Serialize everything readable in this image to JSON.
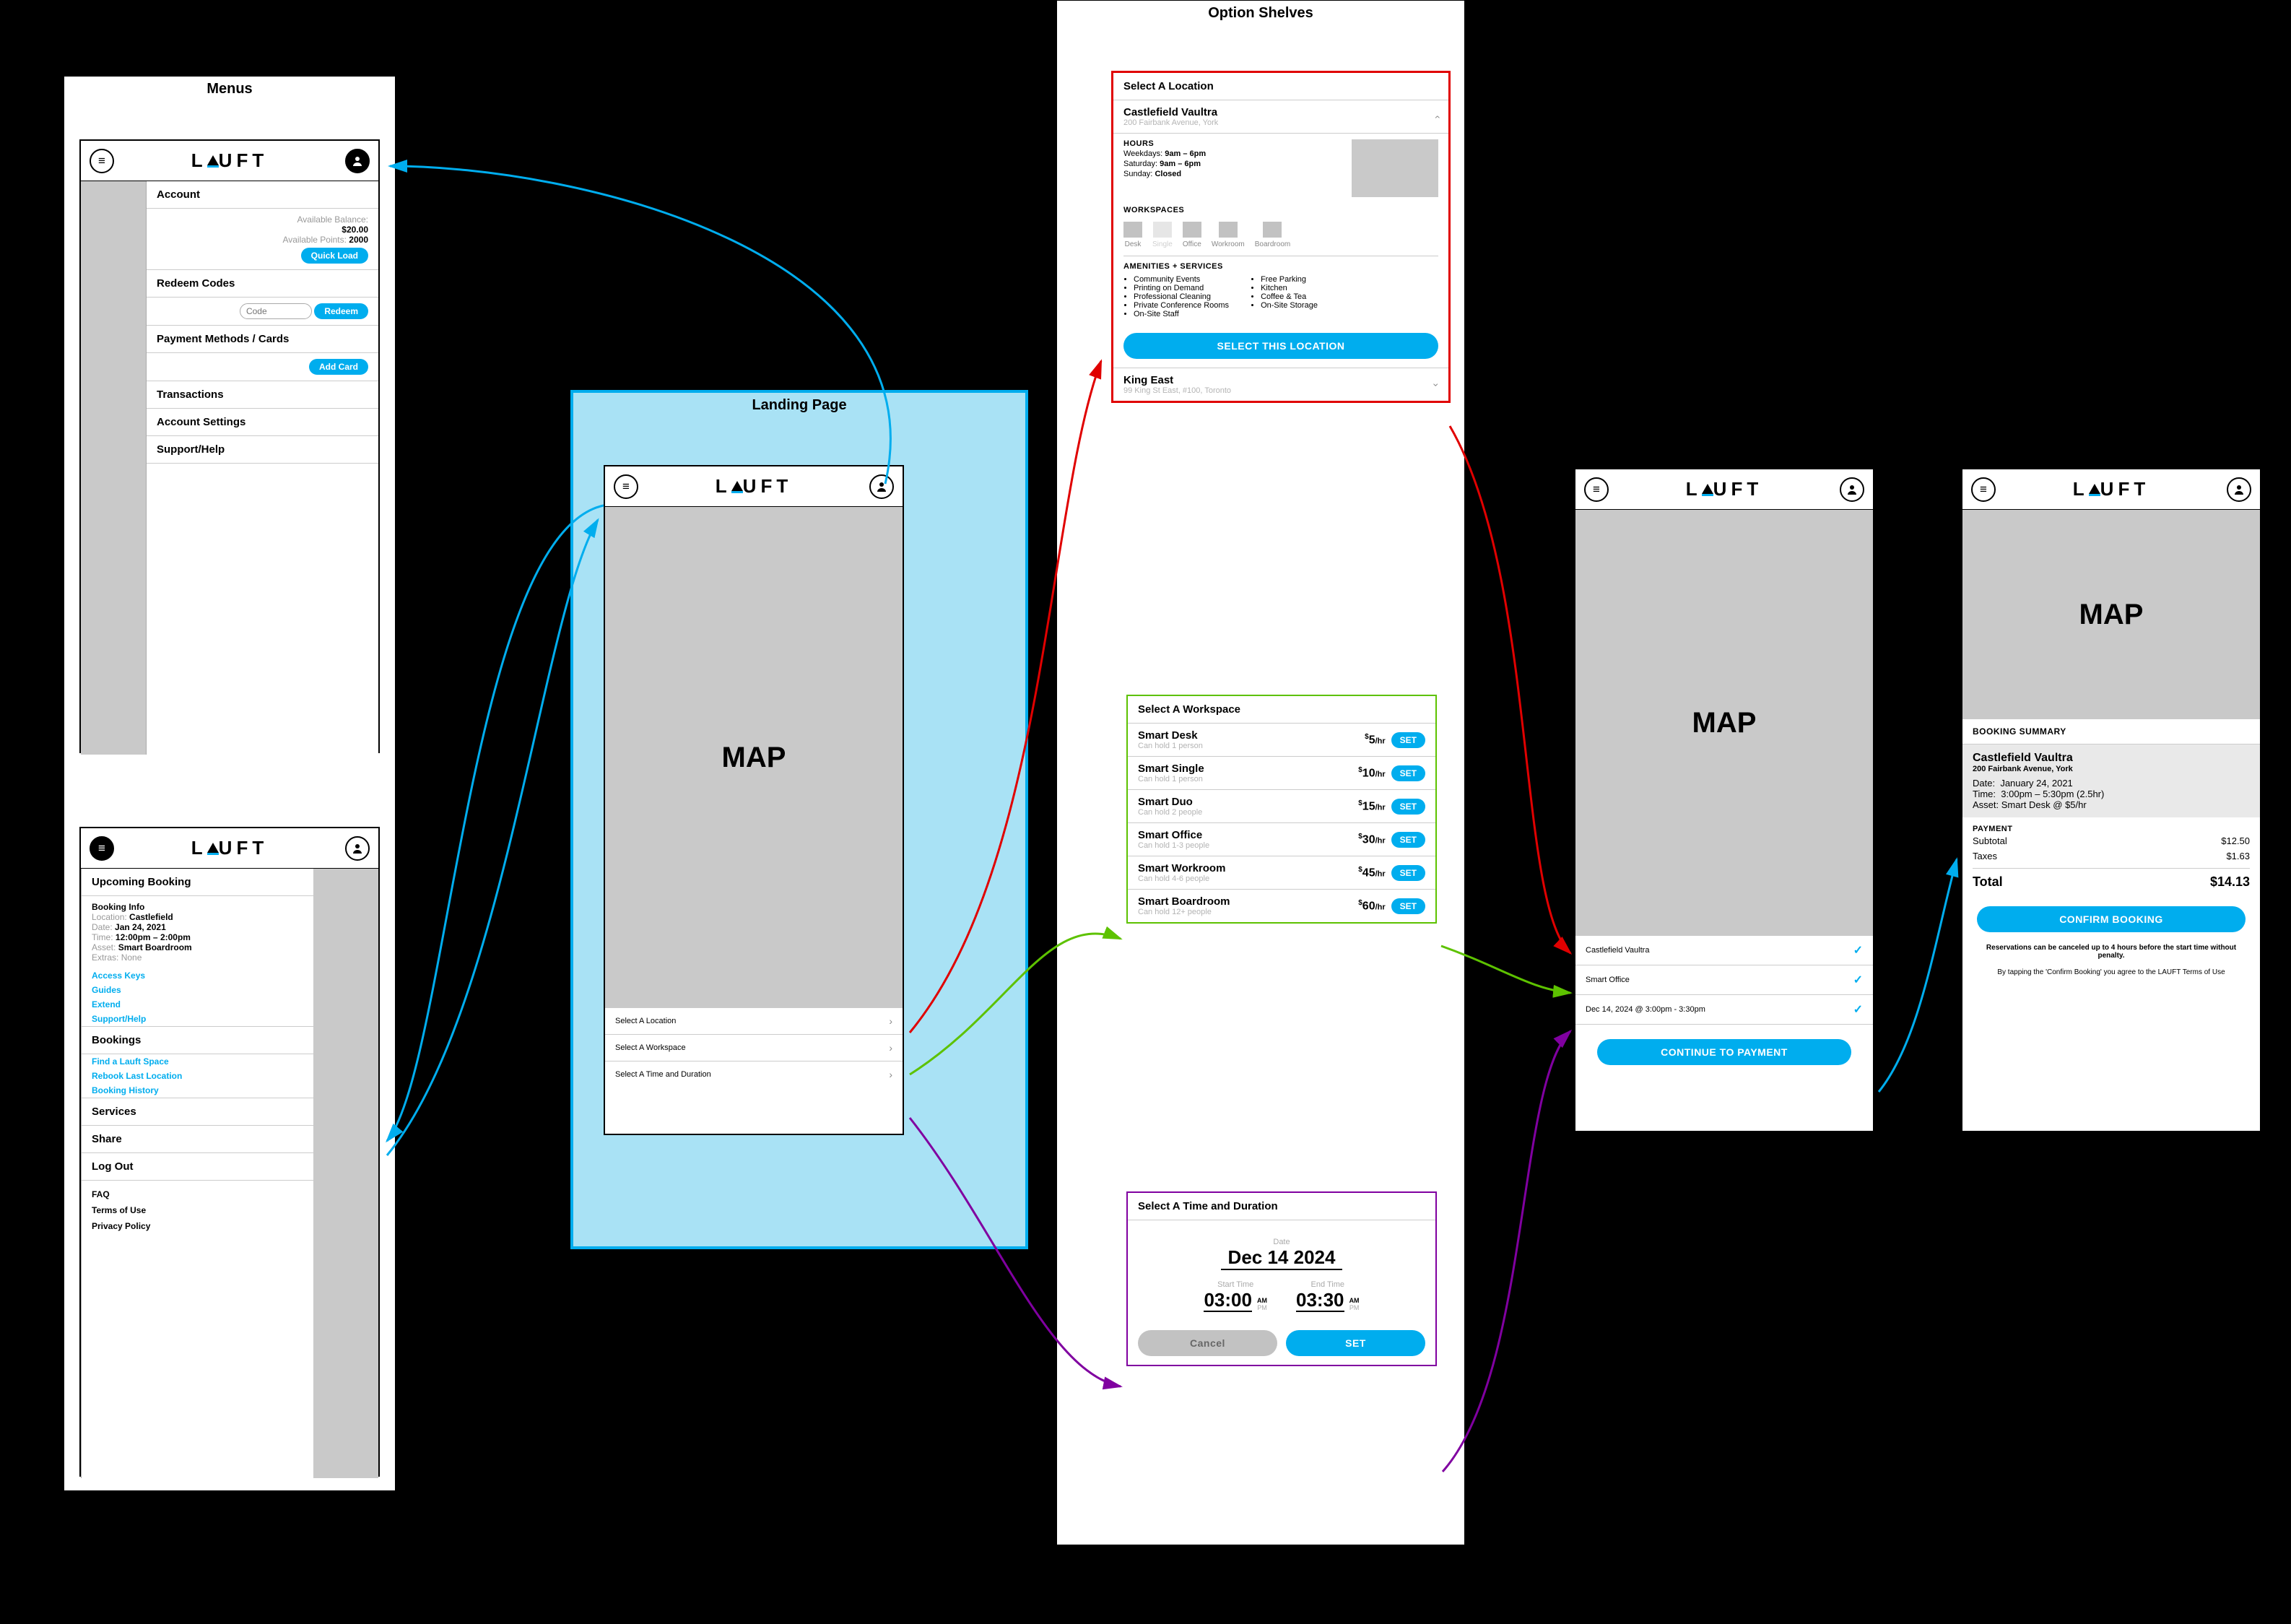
{
  "groups": {
    "menus": "Menus",
    "landing": "Landing Page",
    "shelves": "Option Shelves"
  },
  "logo": "LAUFT",
  "map_label": "MAP",
  "account_menu": {
    "header": "Account",
    "avail_bal_lbl": "Available Balance:",
    "avail_bal": "$20.00",
    "avail_pts_lbl": "Available Points:",
    "avail_pts": "2000",
    "quick_load": "Quick Load",
    "redeem_hd": "Redeem Codes",
    "code_ph": "Code",
    "redeem_btn": "Redeem",
    "pay_hd": "Payment Methods / Cards",
    "add_card": "Add Card",
    "transactions": "Transactions",
    "acct_settings": "Account Settings",
    "support": "Support/Help"
  },
  "main_menu": {
    "upcoming_hd": "Upcoming Booking",
    "info_hd": "Booking Info",
    "loc_lbl": "Location:",
    "loc": "Castlefield",
    "date_lbl": "Date:",
    "date": "Jan 24, 2021",
    "time_lbl": "Time:",
    "time": "12:00pm – 2:00pm",
    "asset_lbl": "Asset:",
    "asset": "Smart Boardroom",
    "extras_lbl": "Extras:",
    "extras": "None",
    "links": [
      "Access Keys",
      "Guides",
      "Extend",
      "Support/Help"
    ],
    "bookings_hd": "Bookings",
    "booking_links": [
      "Find a Lauft Space",
      "Rebook Last Location",
      "Booking History"
    ],
    "services": "Services",
    "share": "Share",
    "logout": "Log Out",
    "footer": [
      "FAQ",
      "Terms of Use",
      "Privacy Policy"
    ]
  },
  "landing": {
    "rows": [
      "Select A Location",
      "Select A Workspace",
      "Select A Time and Duration"
    ]
  },
  "loc_shelf": {
    "title": "Select A Location",
    "loc1_name": "Castlefield Vaultra",
    "loc1_addr": "200 Fairbank Avenue, York",
    "hours_lbl": "HOURS",
    "hours_wd_lbl": "Weekdays:",
    "hours_wd": "9am – 6pm",
    "hours_sat_lbl": "Saturday:",
    "hours_sat": "9am – 6pm",
    "hours_sun_lbl": "Sunday:",
    "hours_sun": "Closed",
    "ws_lbl": "WORKSPACES",
    "ws_icons": [
      "Desk",
      "Single",
      "Office",
      "Workroom",
      "Boardroom"
    ],
    "amen_lbl": "AMENITIES + SERVICES",
    "amen_left": [
      "Community Events",
      "Printing on Demand",
      "Professional Cleaning",
      "Private Conference Rooms",
      "On-Site Staff"
    ],
    "amen_right": [
      "Free Parking",
      "Kitchen",
      "Coffee & Tea",
      "On-Site Storage"
    ],
    "select_btn": "SELECT THIS LOCATION",
    "loc2_name": "King East",
    "loc2_addr": "99 King St East, #100, Toronto"
  },
  "ws_shelf": {
    "title": "Select A Workspace",
    "items": [
      {
        "name": "Smart Desk",
        "sub": "Can hold 1 person",
        "price": "5"
      },
      {
        "name": "Smart Single",
        "sub": "Can hold 1 person",
        "price": "10"
      },
      {
        "name": "Smart Duo",
        "sub": "Can hold 2 people",
        "price": "15"
      },
      {
        "name": "Smart Office",
        "sub": "Can hold 1-3 people",
        "price": "30"
      },
      {
        "name": "Smart Workroom",
        "sub": "Can hold 4-6 people",
        "price": "45"
      },
      {
        "name": "Smart Boardroom",
        "sub": "Can hold 12+ people",
        "price": "60"
      }
    ],
    "set": "SET"
  },
  "time_shelf": {
    "title": "Select A Time and Duration",
    "date_lbl": "Date",
    "date": "Dec 14 2024",
    "start_lbl": "Start Time",
    "start": "03:00",
    "end_lbl": "End Time",
    "end": "03:30",
    "am": "AM",
    "pm": "PM",
    "cancel": "Cancel",
    "set": "SET"
  },
  "review": {
    "row1": "Castlefield Vaultra",
    "row2": "Smart Office",
    "row3": "Dec 14, 2024 @ 3:00pm - 3:30pm",
    "continue": "CONTINUE TO PAYMENT"
  },
  "summary": {
    "hd": "BOOKING SUMMARY",
    "loc": "Castlefield Vaultra",
    "addr": "200 Fairbank Avenue, York",
    "date_lbl": "Date:",
    "date": "January 24, 2021",
    "time_lbl": "Time:",
    "time": "3:00pm – 5:30pm (2.5hr)",
    "asset_lbl": "Asset:",
    "asset": "Smart Desk @ $5/hr",
    "pay_hd": "PAYMENT",
    "subtotal_lbl": "Subtotal",
    "subtotal": "$12.50",
    "taxes_lbl": "Taxes",
    "taxes": "$1.63",
    "total_lbl": "Total",
    "total": "$14.13",
    "confirm": "CONFIRM BOOKING",
    "fine1": "Reservations can be canceled up to 4 hours before the start time without penalty.",
    "fine2": "By tapping the 'Confirm Booking' you agree to the LAUFT Terms of Use"
  }
}
